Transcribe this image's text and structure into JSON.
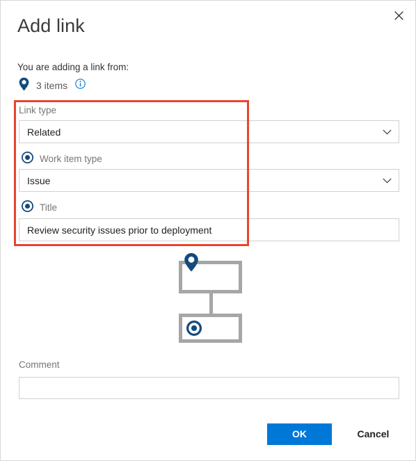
{
  "dialog": {
    "title": "Add link",
    "close_icon": "close-icon"
  },
  "intro": {
    "text": "You are adding a link from:",
    "pin_icon": "map-pin-icon",
    "items_count_label": "3 items",
    "info_icon": "info-icon"
  },
  "form": {
    "link_type": {
      "label": "Link type",
      "value": "Related",
      "chevron_icon": "chevron-down-icon"
    },
    "work_item_type": {
      "radio_icon": "radio-selected-icon",
      "label": "Work item type",
      "value": "Issue",
      "chevron_icon": "chevron-down-icon"
    },
    "title": {
      "radio_icon": "radio-selected-icon",
      "label": "Title",
      "value": "Review security issues prior to deployment"
    },
    "comment": {
      "label": "Comment",
      "value": "",
      "placeholder": ""
    }
  },
  "diagram": {
    "parent_node_icon": "map-pin-icon",
    "child_node_icon": "radio-selected-icon"
  },
  "footer": {
    "ok_label": "OK",
    "cancel_label": "Cancel"
  },
  "annotation": {
    "highlight_color": "#e8452c"
  },
  "colors": {
    "accent_blue": "#0078d7",
    "icon_navy": "#134a7e",
    "text_primary": "#1f1f1f",
    "text_secondary": "#767676",
    "border": "#d0d0d0",
    "diagram_gray": "#a6a6a6"
  }
}
